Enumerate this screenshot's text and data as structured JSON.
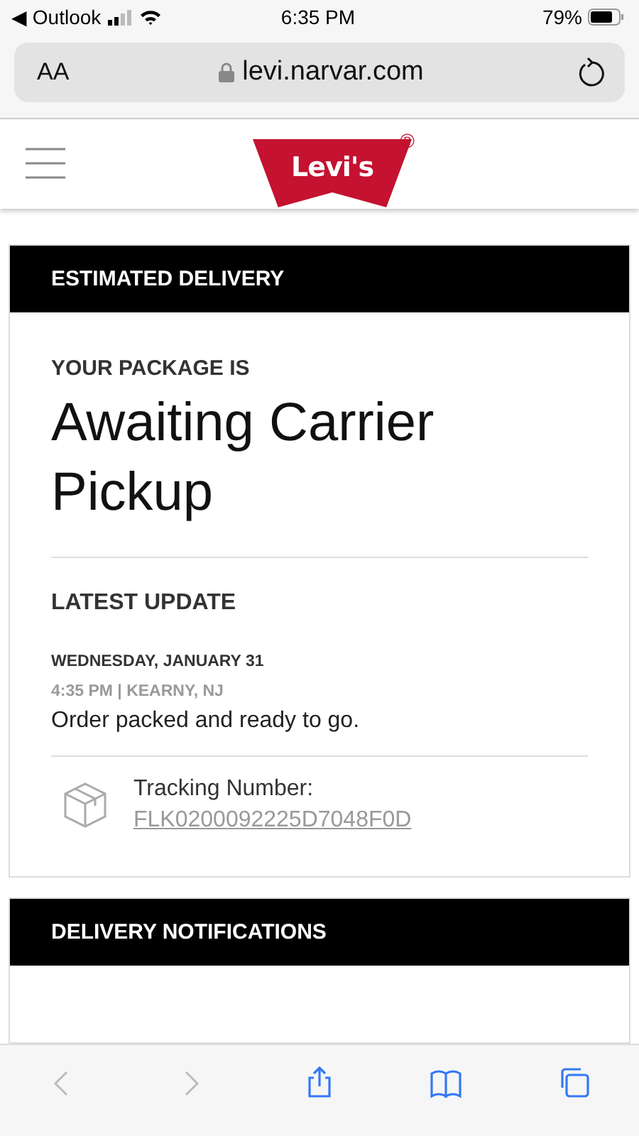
{
  "status_bar": {
    "back_app": "◀ Outlook",
    "time": "6:35 PM",
    "battery": "79%"
  },
  "url_bar": {
    "text_size": "AA",
    "url": "levi.narvar.com"
  },
  "header": {
    "logo": "Levi's",
    "registered": "®"
  },
  "estimated_delivery": {
    "heading": "ESTIMATED DELIVERY",
    "label": "YOUR PACKAGE IS",
    "status": "Awaiting Carrier Pickup",
    "latest_heading": "LATEST UPDATE",
    "date": "WEDNESDAY, JANUARY 31",
    "time_place": "4:35 PM | KEARNY, NJ",
    "message": "Order packed and ready to go.",
    "tracking_label": "Tracking Number:",
    "tracking_number": "FLK0200092225D7048F0D"
  },
  "notifications": {
    "heading": "DELIVERY NOTIFICATIONS"
  },
  "toolbar": [
    {
      "kind": "back",
      "disabled": true
    },
    {
      "kind": "forward",
      "disabled": true
    },
    {
      "kind": "share",
      "disabled": false
    },
    {
      "kind": "bookmarks",
      "disabled": false
    },
    {
      "kind": "tabs",
      "disabled": false
    }
  ]
}
